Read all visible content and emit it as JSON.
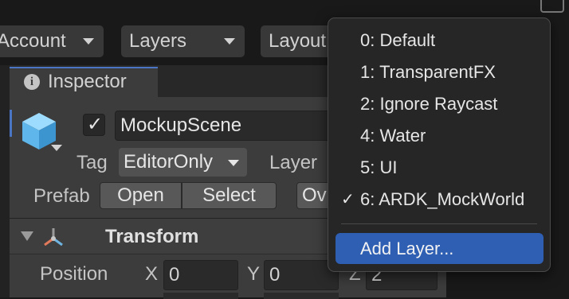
{
  "toolbar": {
    "account_label": "Account",
    "layers_label": "Layers",
    "layout_label": "Layout"
  },
  "inspector": {
    "tab_title": "Inspector",
    "object_name": "MockupScene",
    "object_enabled": true,
    "tag_label": "Tag",
    "tag_value": "EditorOnly",
    "layer_label": "Layer",
    "prefab_label": "Prefab",
    "open_button": "Open",
    "select_button": "Select",
    "overrides_button": "Ov"
  },
  "transform": {
    "title": "Transform",
    "position_label": "Position",
    "x_label": "X",
    "x_value": "0",
    "y_label": "Y",
    "y_value": "0",
    "z_label": "Z",
    "z_value": "2"
  },
  "layer_menu": {
    "items": [
      {
        "label": "0: Default",
        "checked": false
      },
      {
        "label": "1: TransparentFX",
        "checked": false
      },
      {
        "label": "2: Ignore Raycast",
        "checked": false
      },
      {
        "label": "4: Water",
        "checked": false
      },
      {
        "label": "5: UI",
        "checked": false
      },
      {
        "label": "6: ARDK_MockWorld",
        "checked": true
      }
    ],
    "check_mark": "✓",
    "add_layer_label": "Add Layer..."
  },
  "colors": {
    "accent": "#2f5fb3",
    "tab_highlight": "#4a74c4",
    "cube_icon": "#6cc0f0"
  }
}
